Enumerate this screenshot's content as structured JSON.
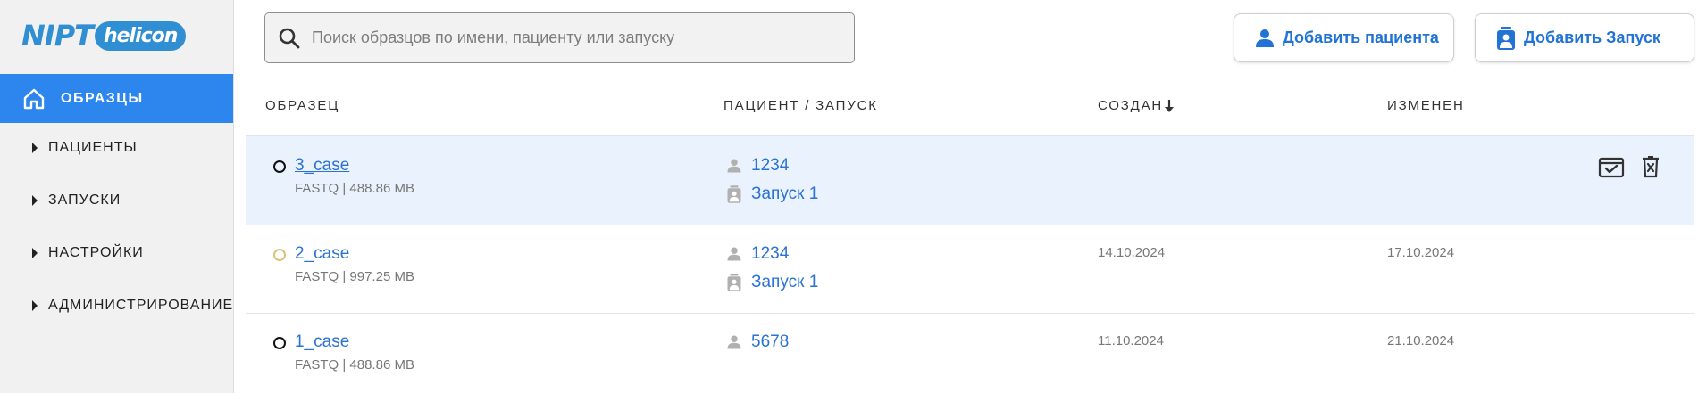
{
  "logo": {
    "part1": "NIPT",
    "part2": "helicon"
  },
  "sidebar": {
    "active": {
      "label": "ОБРАЗЦЫ",
      "icon": "home-icon"
    },
    "items": [
      {
        "label": "ПАЦИЕНТЫ"
      },
      {
        "label": "ЗАПУСКИ"
      },
      {
        "label": "НАСТРОЙКИ"
      },
      {
        "label": "АДМИНИСТРИРОВАНИЕ"
      }
    ]
  },
  "search": {
    "placeholder": "Поиск образцов по имени, пациенту или запуску",
    "value": ""
  },
  "buttons": {
    "add_patient": "Добавить пациента",
    "add_run": "Добавить Запуск"
  },
  "table": {
    "headers": {
      "sample": "ОБРАЗЕЦ",
      "patient_run": "ПАЦИЕНТ / ЗАПУСК",
      "created": "СОЗДАН",
      "modified": "ИЗМЕНЕН"
    },
    "sort": {
      "column": "created",
      "direction": "down"
    },
    "rows": [
      {
        "name": "3_case",
        "meta": "FASTQ | 488.86 MB",
        "status_color": "#111111",
        "patient": "1234",
        "run": "Запуск 1",
        "created": "",
        "modified": "",
        "selected": true
      },
      {
        "name": "2_case",
        "meta": "FASTQ | 997.25 MB",
        "status_color": "#d9c27a",
        "patient": "1234",
        "run": "Запуск 1",
        "created": "14.10.2024",
        "modified": "17.10.2024",
        "selected": false
      },
      {
        "name": "1_case",
        "meta": "FASTQ | 488.86 MB",
        "status_color": "#111111",
        "patient": "5678",
        "run": "",
        "created": "11.10.2024",
        "modified": "21.10.2024",
        "selected": false
      }
    ]
  },
  "colors": {
    "accent": "#2d86ee",
    "link": "#2a72d3",
    "selected_row": "#eaf2fe",
    "sidebar_bg": "#f1f1f1"
  }
}
